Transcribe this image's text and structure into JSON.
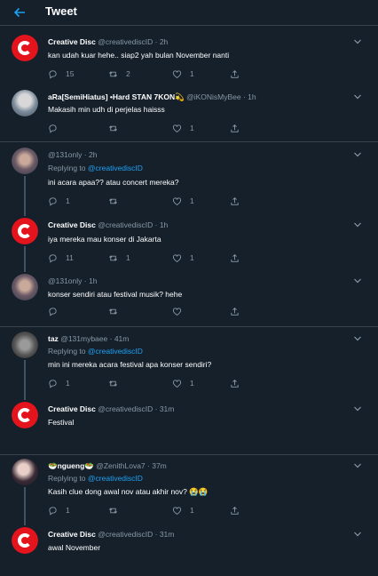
{
  "header": {
    "title": "Tweet",
    "back_icon": "arrow-left-icon"
  },
  "colors": {
    "background": "#15202b",
    "accent": "#1da1f2",
    "muted": "#8899a6",
    "border": "#38444d",
    "brand_red": "#e3141c"
  },
  "tweets": [
    {
      "name": "Creative Disc",
      "handle": "@creativediscID",
      "time": "2h",
      "text": "kan udah kuar hehe.. siap2 yah bulan November nanti",
      "replies": "15",
      "retweets": "2",
      "likes": "1"
    },
    {
      "name": "aRa[SemiHiatus] •Hard STAN 7KON💫",
      "handle": "@iKONisMyBee",
      "time": "1h",
      "text": "Makasih min udh di perjelas haisss",
      "replies": "",
      "retweets": "",
      "likes": "1"
    },
    {
      "name": "",
      "handle": "@131only",
      "time": "2h",
      "reply_to": "Replying to",
      "mention": "@creativediscID",
      "text": "ini acara apaa?? atau concert mereka?",
      "replies": "1",
      "retweets": "",
      "likes": "1"
    },
    {
      "name": "Creative Disc",
      "handle": "@creativediscID",
      "time": "1h",
      "text": "iya mereka mau konser di Jakarta",
      "replies": "11",
      "retweets": "1",
      "likes": "1"
    },
    {
      "name": "",
      "handle": "@131only",
      "time": "1h",
      "text": "konser sendiri atau festival musik? hehe",
      "replies": "",
      "retweets": "",
      "likes": ""
    },
    {
      "name": "taz",
      "handle": "@131mybaee",
      "time": "41m",
      "reply_to": "Replying to",
      "mention": "@creativediscID",
      "text": "min ini mereka acara festival apa konser sendiri?",
      "replies": "1",
      "retweets": "",
      "likes": "1"
    },
    {
      "name": "Creative Disc",
      "handle": "@creativediscID",
      "time": "31m",
      "text": "Festival",
      "replies": "",
      "retweets": "",
      "likes": ""
    },
    {
      "name": "🥗ngueng🥗",
      "handle": "@ZenithLova7",
      "time": "37m",
      "reply_to": "Replying to",
      "mention": "@creativediscID",
      "text": "Kasih clue dong awal nov atau akhir nov? 😭😭",
      "replies": "1",
      "retweets": "",
      "likes": "1"
    },
    {
      "name": "Creative Disc",
      "handle": "@creativediscID",
      "time": "31m",
      "text": "awal November",
      "replies": "",
      "retweets": "",
      "likes": ""
    }
  ]
}
